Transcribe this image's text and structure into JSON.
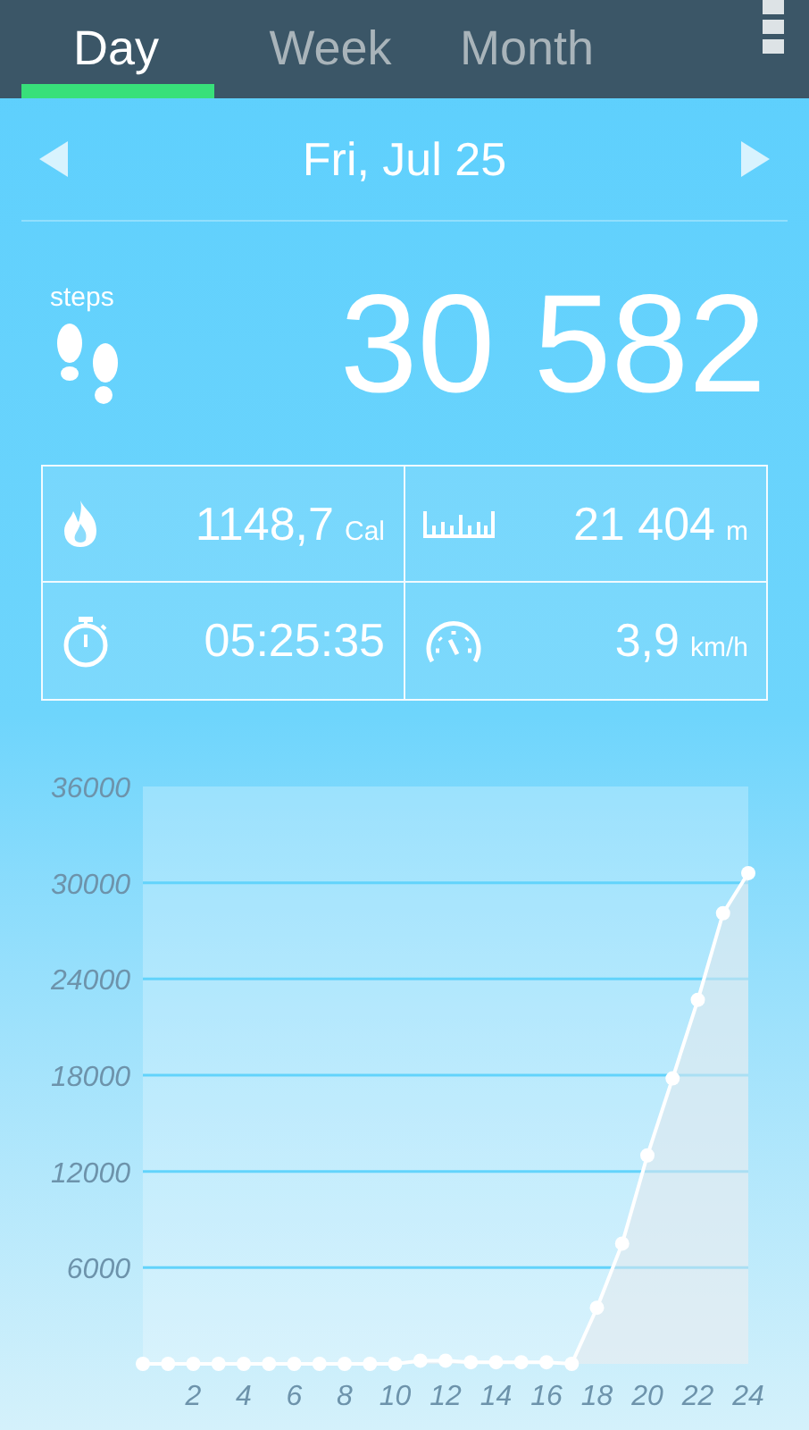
{
  "tabs": [
    {
      "label": "Day",
      "selected": true
    },
    {
      "label": "Week",
      "selected": false
    },
    {
      "label": "Month",
      "selected": false
    }
  ],
  "date": "Fri, Jul 25",
  "steps": {
    "label": "steps",
    "value": "30 582"
  },
  "stats": [
    {
      "kind": "calories",
      "value": "1148,7",
      "unit": "Cal"
    },
    {
      "kind": "distance",
      "value": "21 404",
      "unit": "m"
    },
    {
      "kind": "duration",
      "value": "05:25:35"
    },
    {
      "kind": "speed",
      "value": "3,9",
      "unit": "km/h"
    }
  ],
  "chart_data": {
    "type": "line",
    "x": [
      0,
      1,
      2,
      3,
      4,
      5,
      6,
      7,
      8,
      9,
      10,
      11,
      12,
      13,
      14,
      15,
      16,
      17,
      18,
      19,
      20,
      21,
      22,
      23,
      24
    ],
    "series": [
      {
        "color": "#ffffff",
        "marker": true,
        "values": [
          0,
          0,
          0,
          0,
          0,
          0,
          0,
          0,
          0,
          0,
          0,
          200,
          200,
          100,
          100,
          100,
          100,
          0,
          3500,
          7500,
          13000,
          17800,
          22700,
          28100,
          30600
        ]
      }
    ],
    "grid": true,
    "xlim": [
      0,
      24
    ],
    "ylim": [
      0,
      36000
    ],
    "xticks": [
      2,
      4,
      6,
      8,
      10,
      12,
      14,
      16,
      18,
      20,
      22,
      24
    ],
    "yticks": [
      6000,
      12000,
      18000,
      24000,
      30000,
      36000
    ]
  }
}
